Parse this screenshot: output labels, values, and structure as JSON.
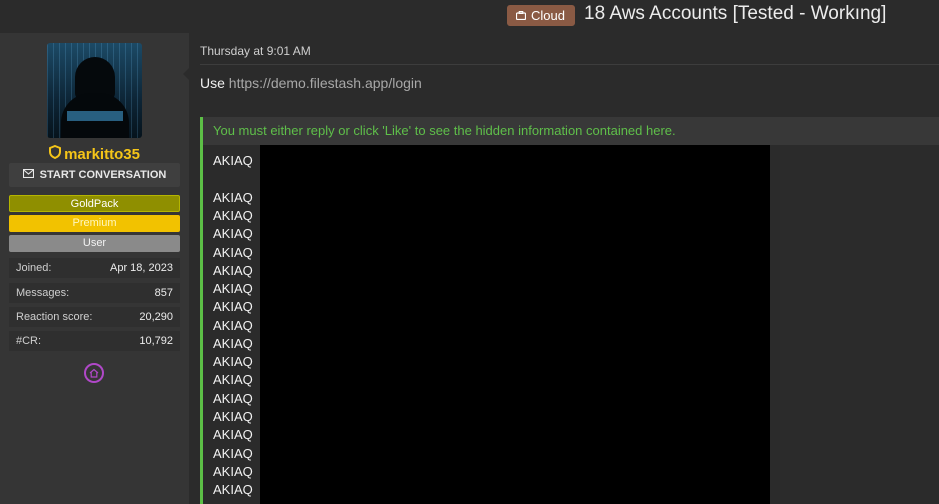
{
  "thread": {
    "prefix": "Cloud",
    "title": "18 Aws Accounts [Tested - Workıng]"
  },
  "user": {
    "name": "markitto35",
    "start_conversation": "START CONVERSATION",
    "banners": [
      "GoldPack",
      "Premium",
      "User"
    ],
    "stats": [
      {
        "label": "Joined:",
        "value": "Apr 18, 2023"
      },
      {
        "label": "Messages:",
        "value": "857"
      },
      {
        "label": "Reaction score:",
        "value": "20,290"
      },
      {
        "label": "#CR:",
        "value": "10,792"
      }
    ]
  },
  "post": {
    "date": "Thursday at 9:01 AM",
    "use_prefix": "Use",
    "link": "https://demo.filestash.app/login",
    "hidden_notice": "You must either reply or click 'Like' to see the hidden information contained here.",
    "keys": [
      "AKIAQ",
      "",
      "AKIAQ",
      "AKIAQ",
      "AKIAQ",
      "AKIAQ",
      "AKIAQ",
      "AKIAQ",
      "AKIAQ",
      "AKIAQ",
      "AKIAQ",
      "AKIAQ",
      "AKIAQ",
      "AKIAQ",
      "AKIAQ",
      "AKIAQ",
      "AKIAQ",
      "AKIAQ",
      "AKIAQ"
    ]
  },
  "colors": {
    "accent_green": "#5fbf4a",
    "username_gold": "#f5c518",
    "prefix_bg": "#8a5a44"
  },
  "icons": [
    "briefcase-icon",
    "shield-icon",
    "envelope-icon",
    "home-icon"
  ]
}
